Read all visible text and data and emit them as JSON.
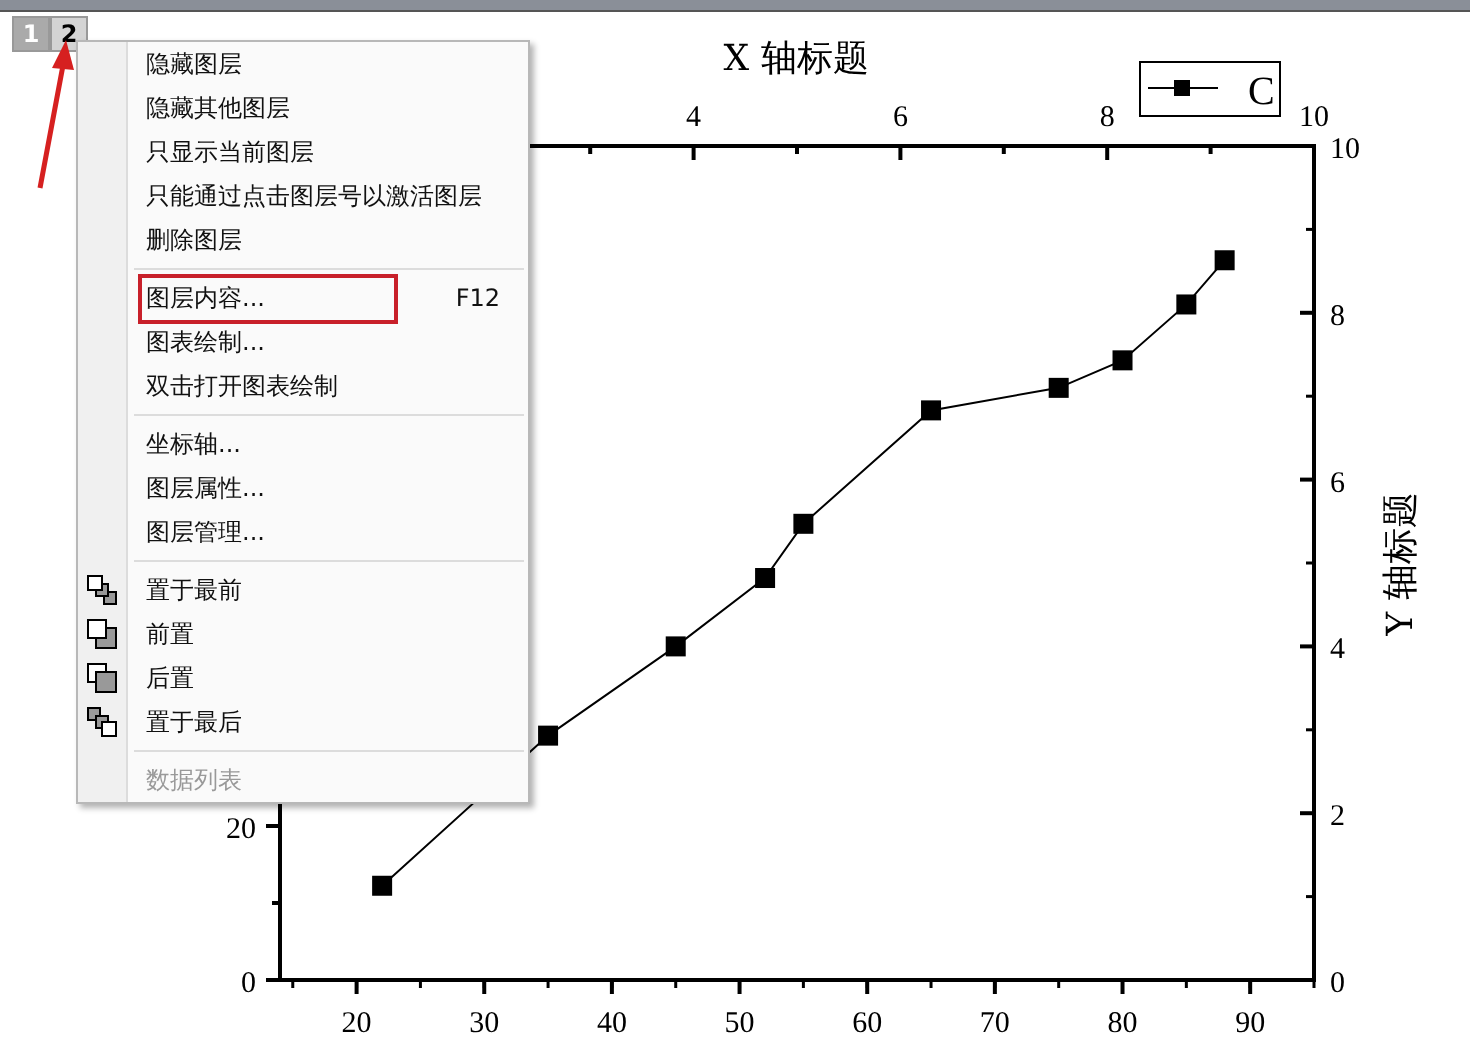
{
  "layer_tabs": [
    {
      "label": "1",
      "selected": false
    },
    {
      "label": "2",
      "selected": true
    }
  ],
  "graph": {
    "x_title": "X 轴标题",
    "y_title": "Y 轴标题",
    "top_axis_labels": [
      "4",
      "6",
      "8",
      "10"
    ],
    "left_axis_labels": [
      "20",
      "0"
    ],
    "chart_data": {
      "type": "line",
      "xlim": [
        14,
        95
      ],
      "ylim": [
        0,
        10
      ],
      "xticks": [
        20,
        30,
        40,
        50,
        60,
        70,
        80,
        90
      ],
      "yticks": [
        0,
        2,
        4,
        6,
        8,
        10
      ],
      "x": [
        22,
        35,
        45,
        52,
        55,
        65,
        75,
        80,
        85,
        88
      ],
      "series": [
        {
          "name": "C",
          "color": "#000000",
          "marker": "square",
          "values": [
            1.13,
            2.93,
            4.0,
            4.82,
            5.47,
            6.83,
            7.1,
            7.43,
            8.1,
            8.63
          ]
        }
      ]
    }
  },
  "context_menu": {
    "groups": [
      [
        {
          "label": "隐藏图层",
          "kind": "plain",
          "disabled": false,
          "highlighted": false
        },
        {
          "label": "隐藏其他图层",
          "kind": "plain",
          "disabled": false,
          "highlighted": false
        },
        {
          "label": "只显示当前图层",
          "kind": "plain",
          "disabled": false,
          "highlighted": false
        },
        {
          "label": "只能通过点击图层号以激活图层",
          "kind": "plain",
          "disabled": false,
          "highlighted": false
        },
        {
          "label": "删除图层",
          "kind": "plain",
          "disabled": false,
          "highlighted": false
        }
      ],
      [
        {
          "label": "图层内容...",
          "shortcut": "F12",
          "kind": "plain",
          "disabled": false,
          "highlighted": true
        },
        {
          "label": "图表绘制...",
          "kind": "plain",
          "disabled": false,
          "highlighted": false
        },
        {
          "label": "双击打开图表绘制",
          "kind": "plain",
          "disabled": false,
          "highlighted": false
        }
      ],
      [
        {
          "label": "坐标轴...",
          "kind": "plain",
          "disabled": false,
          "highlighted": false
        },
        {
          "label": "图层属性...",
          "kind": "plain",
          "disabled": false,
          "highlighted": false
        },
        {
          "label": "图层管理...",
          "kind": "plain",
          "disabled": false,
          "highlighted": false
        }
      ],
      [
        {
          "label": "置于最前",
          "kind": "to-front",
          "disabled": false,
          "highlighted": false
        },
        {
          "label": "前置",
          "kind": "forward",
          "disabled": false,
          "highlighted": false
        },
        {
          "label": "后置",
          "kind": "backward",
          "disabled": false,
          "highlighted": false
        },
        {
          "label": "置于最后",
          "kind": "to-back",
          "disabled": false,
          "highlighted": false
        }
      ],
      [
        {
          "label": "数据列表",
          "kind": "plain",
          "disabled": true,
          "highlighted": false
        }
      ]
    ]
  }
}
